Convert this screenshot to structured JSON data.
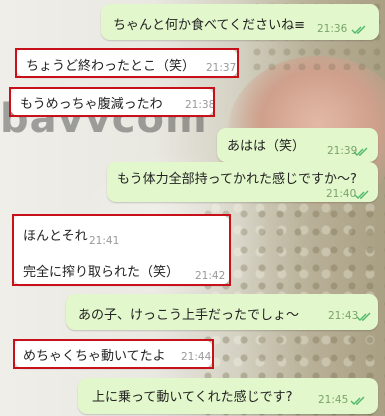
{
  "background": {
    "watermark": "bavvcom"
  },
  "messages": [
    {
      "text": "ちゃんと何か食べてくださいね≡",
      "time": "21:36",
      "direction": "outgoing",
      "read": true
    },
    {
      "text": "ちょうど終わったとこ（笑）",
      "time": "21:37",
      "direction": "incoming"
    },
    {
      "text": "もうめっちゃ腹減ったわ",
      "time": "21:38",
      "direction": "incoming"
    },
    {
      "text": "あはは（笑）",
      "time": "21:39",
      "direction": "outgoing",
      "read": true
    },
    {
      "text": "もう体力全部持ってかれた感じですか〜?",
      "time": "21:40",
      "direction": "outgoing",
      "read": true
    },
    {
      "text": "ほんとそれ",
      "time": "21:41",
      "direction": "incoming"
    },
    {
      "text": "完全に搾り取られた（笑）",
      "time": "21:42",
      "direction": "incoming"
    },
    {
      "text": "あの子、けっこう上手だったでしょ〜",
      "time": "21:43",
      "direction": "outgoing",
      "read": true
    },
    {
      "text": "めちゃくちゃ動いてたよ",
      "time": "21:44",
      "direction": "incoming"
    },
    {
      "text": "上に乗って動いてくれた感じです?",
      "time": "21:45",
      "direction": "outgoing",
      "read": true
    }
  ],
  "colors": {
    "outgoing": "#e2f7cb",
    "incoming": "#ffffff",
    "read_tick": "#4fb86a",
    "highlight": "#c8101a"
  },
  "icons": {
    "read": "double-check-icon"
  }
}
